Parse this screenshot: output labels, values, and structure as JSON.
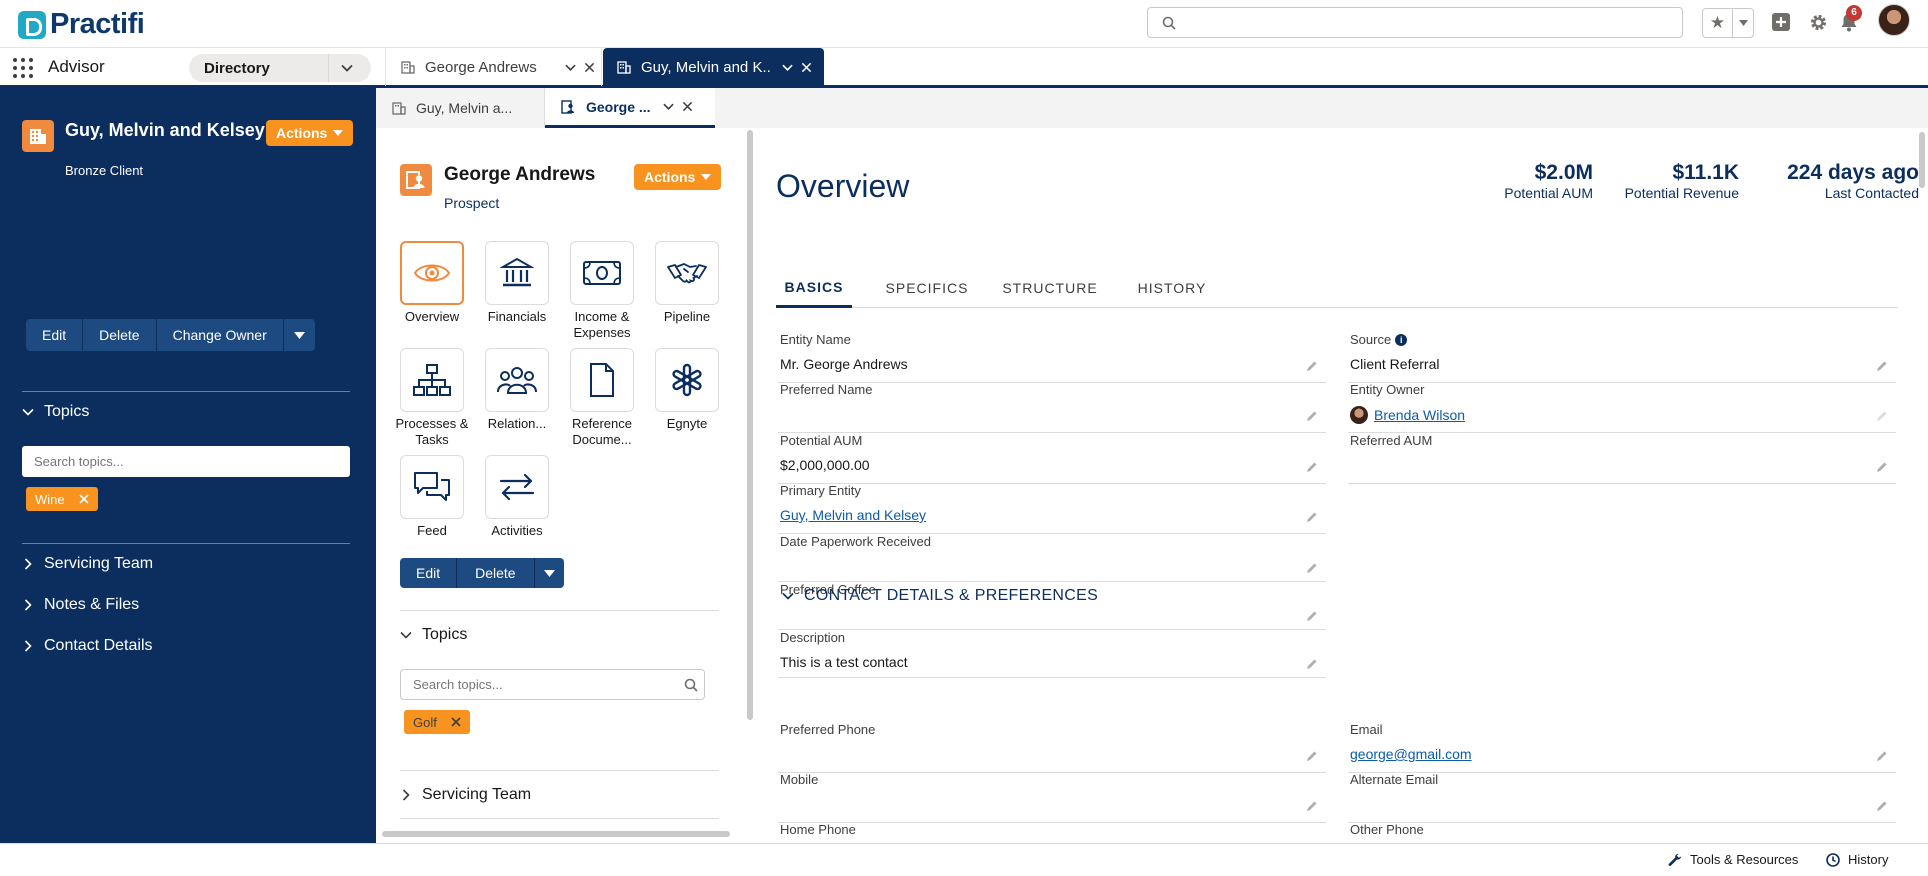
{
  "header": {
    "logo_text": "Practifi",
    "search_placeholder": "",
    "notification_count": "6"
  },
  "nav": {
    "app_name": "Advisor",
    "object_select": "Directory",
    "tabs": [
      {
        "label": "George Andrews"
      },
      {
        "label": "Guy, Melvin and K..."
      }
    ]
  },
  "left_panel": {
    "title": "Guy, Melvin and Kelsey",
    "subtitle": "Bronze Client",
    "actions_label": "Actions",
    "buttons": [
      "Edit",
      "Delete",
      "Change Owner"
    ],
    "sections": {
      "topics": "Topics",
      "servicing_team": "Servicing Team",
      "notes_files": "Notes & Files",
      "contact_details": "Contact Details"
    },
    "topics_placeholder": "Search topics...",
    "topic_pills": [
      "Wine"
    ]
  },
  "subtabs": [
    {
      "label": "Guy, Melvin a..."
    },
    {
      "label": "George ..."
    }
  ],
  "mid_panel": {
    "title": "George Andrews",
    "subtitle": "Prospect",
    "actions_label": "Actions",
    "tiles": [
      {
        "label": "Overview",
        "icon": "eye-icon"
      },
      {
        "label": "Financials",
        "icon": "bank-icon"
      },
      {
        "label": "Income & Expenses",
        "icon": "money-icon"
      },
      {
        "label": "Pipeline",
        "icon": "handshake-icon"
      },
      {
        "label": "Processes & Tasks",
        "icon": "hierarchy-icon"
      },
      {
        "label": "Relation...",
        "icon": "people-icon"
      },
      {
        "label": "Reference Docume...",
        "icon": "document-icon"
      },
      {
        "label": "Egnyte",
        "icon": "egnyte-icon"
      },
      {
        "label": "Feed",
        "icon": "chat-icon"
      },
      {
        "label": "Activities",
        "icon": "swap-arrows-icon"
      }
    ],
    "buttons": [
      "Edit",
      "Delete"
    ],
    "sections": {
      "topics": "Topics",
      "servicing_team": "Servicing Team"
    },
    "topics_placeholder": "Search topics...",
    "topic_pills": [
      "Golf"
    ]
  },
  "main": {
    "title": "Overview",
    "stats": [
      {
        "value": "$2.0M",
        "label": "Potential AUM"
      },
      {
        "value": "$11.1K",
        "label": "Potential Revenue"
      },
      {
        "value": "224 days ago",
        "label": "Last Contacted"
      }
    ],
    "tabs": [
      "BASICS",
      "SPECIFICS",
      "STRUCTURE",
      "HISTORY"
    ],
    "fields_left": [
      {
        "label": "Entity Name",
        "value": "Mr. George Andrews"
      },
      {
        "label": "Preferred Name",
        "value": ""
      },
      {
        "label": "Potential AUM",
        "value": "$2,000,000.00"
      },
      {
        "label": "Primary Entity",
        "value": "Guy, Melvin and Kelsey"
      },
      {
        "label": "Date Paperwork Received",
        "value": ""
      },
      {
        "label": "Preferred Coffee",
        "value": ""
      },
      {
        "label": "Description",
        "value": "This is a test contact"
      }
    ],
    "fields_right": [
      {
        "label": "Source",
        "value": "Client Referral"
      },
      {
        "label": "Entity Owner",
        "value": "Brenda Wilson"
      },
      {
        "label": "Referred AUM",
        "value": ""
      }
    ],
    "section_title": "CONTACT DETAILS & PREFERENCES",
    "contact_left": [
      {
        "label": "Preferred Phone",
        "value": ""
      },
      {
        "label": "Mobile",
        "value": ""
      },
      {
        "label": "Home Phone",
        "value": ""
      }
    ],
    "contact_right": [
      {
        "label": "Email",
        "value": "george@gmail.com"
      },
      {
        "label": "Alternate Email",
        "value": ""
      },
      {
        "label": "Other Phone",
        "value": ""
      }
    ]
  },
  "footer": {
    "tools": "Tools & Resources",
    "history": "History"
  },
  "colors": {
    "navy": "#0b2e5f",
    "orange": "#f7931e",
    "link": "#0b5cab"
  }
}
